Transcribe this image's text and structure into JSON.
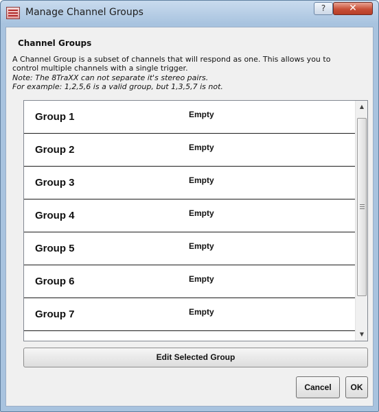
{
  "window": {
    "title": "Manage Channel Groups",
    "help_label": "?",
    "close_label": "✕"
  },
  "section": {
    "title": "Channel Groups",
    "description_line1": "A Channel Group is a subset of channels that will respond as one.  This allows you to",
    "description_line2": "control multiple channels with a single trigger.",
    "note_line1": "Note: The 8TraXX can not separate it's stereo pairs.",
    "note_line2": "For example: 1,2,5,6 is a valid group, but 1,3,5,7 is not."
  },
  "groups": [
    {
      "name": "Group 1",
      "status": "Empty"
    },
    {
      "name": "Group 2",
      "status": "Empty"
    },
    {
      "name": "Group 3",
      "status": "Empty"
    },
    {
      "name": "Group 4",
      "status": "Empty"
    },
    {
      "name": "Group 5",
      "status": "Empty"
    },
    {
      "name": "Group 6",
      "status": "Empty"
    },
    {
      "name": "Group 7",
      "status": "Empty"
    }
  ],
  "buttons": {
    "edit_selected": "Edit Selected Group",
    "cancel": "Cancel",
    "ok": "OK"
  },
  "icons": {
    "app": "app-icon",
    "help": "help-icon",
    "close": "close-icon",
    "scroll_up": "arrow-up-icon",
    "scroll_down": "arrow-down-icon"
  }
}
